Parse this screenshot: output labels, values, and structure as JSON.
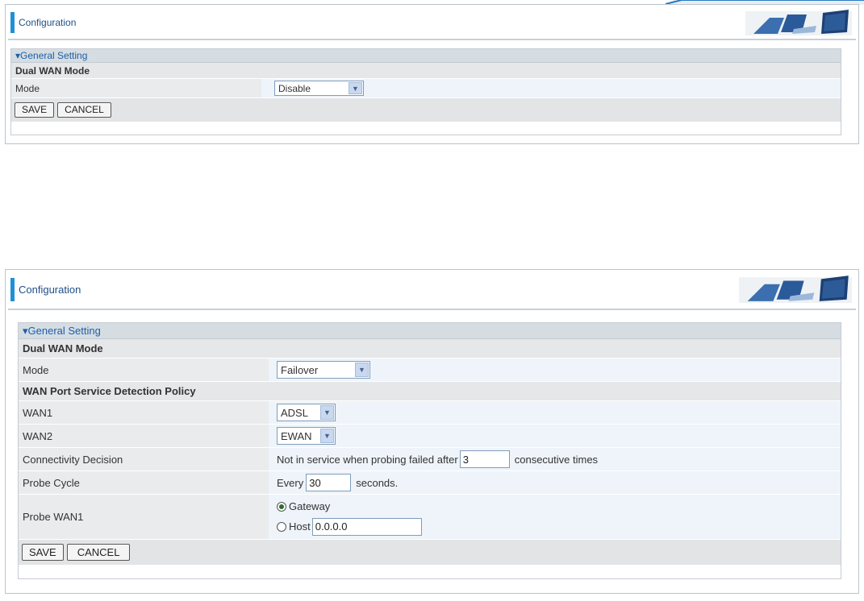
{
  "screen1": {
    "header": {
      "title": "Configuration"
    },
    "section": {
      "title": "▾General Setting"
    },
    "dual_wan_mode": "Dual WAN Mode",
    "mode": {
      "label": "Mode",
      "value": "Disable"
    },
    "buttons": {
      "save": "SAVE",
      "cancel": "CANCEL"
    }
  },
  "screen2": {
    "header": {
      "title": "Configuration"
    },
    "section": {
      "title": "▾General Setting"
    },
    "dual_wan_mode": "Dual WAN Mode",
    "mode": {
      "label": "Mode",
      "value": "Failover"
    },
    "policy_title": "WAN Port Service Detection Policy",
    "wan1": {
      "label": "WAN1",
      "value": "ADSL"
    },
    "wan2": {
      "label": "WAN2",
      "value": "EWAN"
    },
    "connectivity": {
      "label": "Connectivity Decision",
      "prefix": "Not in service when probing failed after",
      "value": "3",
      "suffix": "consecutive times"
    },
    "probe_cycle": {
      "label": "Probe Cycle",
      "prefix": "Every",
      "value": "30",
      "suffix": "seconds."
    },
    "probe_wan1": {
      "label": "Probe WAN1",
      "gateway_label": "Gateway",
      "host_label": "Host",
      "host_value": "0.0.0.0",
      "selected": "Gateway"
    },
    "buttons": {
      "save": "SAVE",
      "cancel": "CANCEL"
    }
  },
  "colors": {
    "accent": "#1f8fd6",
    "title_text": "#1f4f86",
    "section_text": "#1d5fa8"
  },
  "icons": {
    "dropdown": "chevron-down-icon",
    "header_image": "computer-monitor-illustration"
  }
}
